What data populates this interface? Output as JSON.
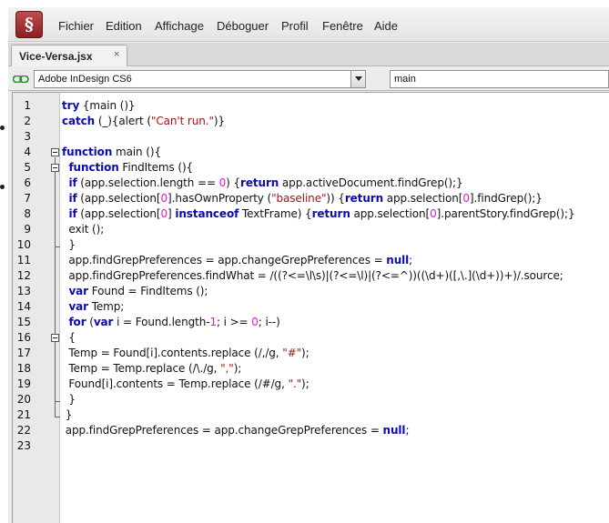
{
  "window": {
    "menu": [
      "Fichier",
      "Edition",
      "Affichage",
      "Déboguer",
      "Profil",
      "Fenêtre",
      "Aide"
    ]
  },
  "tab": {
    "label": "Vice-Versa.jsx",
    "close_glyph": "×"
  },
  "target": {
    "application": "Adobe InDesign CS6",
    "function": "main"
  },
  "icons": {
    "app": "extendscript-toolkit-icon",
    "link": "link-icon"
  },
  "colors": {
    "keyword": "#0b0bb0",
    "string": "#a31515",
    "number": "#e01ad8"
  },
  "editor": {
    "lines": [
      [
        {
          "t": "try",
          "c": "kw"
        },
        {
          "t": " {main ()}"
        }
      ],
      [
        {
          "t": "catch",
          "c": "kw"
        },
        {
          "t": " (_){alert ("
        },
        {
          "t": "\"Can't run.\"",
          "c": "str"
        },
        {
          "t": ")}"
        }
      ],
      [],
      [
        {
          "t": "function",
          "c": "kw"
        },
        {
          "t": " main (){"
        }
      ],
      [
        {
          "t": "  "
        },
        {
          "t": "function",
          "c": "kw"
        },
        {
          "t": " FindItems (){"
        }
      ],
      [
        {
          "t": "  "
        },
        {
          "t": "if",
          "c": "kw"
        },
        {
          "t": " (app.selection.length == "
        },
        {
          "t": "0",
          "c": "num"
        },
        {
          "t": ") {"
        },
        {
          "t": "return",
          "c": "kw"
        },
        {
          "t": " app.activeDocument.findGrep();}"
        }
      ],
      [
        {
          "t": "  "
        },
        {
          "t": "if",
          "c": "kw"
        },
        {
          "t": " (app.selection["
        },
        {
          "t": "0",
          "c": "num"
        },
        {
          "t": "].hasOwnProperty ("
        },
        {
          "t": "\"baseline\"",
          "c": "str"
        },
        {
          "t": ")) {"
        },
        {
          "t": "return",
          "c": "kw"
        },
        {
          "t": " app.selection["
        },
        {
          "t": "0",
          "c": "num"
        },
        {
          "t": "].findGrep();}"
        }
      ],
      [
        {
          "t": "  "
        },
        {
          "t": "if",
          "c": "kw"
        },
        {
          "t": " (app.selection["
        },
        {
          "t": "0",
          "c": "num"
        },
        {
          "t": "] "
        },
        {
          "t": "instanceof",
          "c": "kw"
        },
        {
          "t": " TextFrame) {"
        },
        {
          "t": "return",
          "c": "kw"
        },
        {
          "t": " app.selection["
        },
        {
          "t": "0",
          "c": "num"
        },
        {
          "t": "].parentStory.findGrep();}"
        }
      ],
      [
        {
          "t": "  exit ();"
        }
      ],
      [
        {
          "t": "  }"
        }
      ],
      [
        {
          "t": "  app.findGrepPreferences = app.changeGrepPreferences = "
        },
        {
          "t": "null",
          "c": "kw"
        },
        {
          "t": ";"
        }
      ],
      [
        {
          "t": "  app.findGrepPreferences.findWhat = /((?<=\\l\\s)|(?<=\\l)|(?<=^))((\\d+)([,\\.](\\d+))+)/.source;"
        }
      ],
      [
        {
          "t": "  "
        },
        {
          "t": "var",
          "c": "kw"
        },
        {
          "t": " Found = FindItems ();"
        }
      ],
      [
        {
          "t": "  "
        },
        {
          "t": "var",
          "c": "kw"
        },
        {
          "t": " Temp;"
        }
      ],
      [
        {
          "t": "  "
        },
        {
          "t": "for",
          "c": "kw"
        },
        {
          "t": " ("
        },
        {
          "t": "var",
          "c": "kw"
        },
        {
          "t": " i = Found.length-"
        },
        {
          "t": "1",
          "c": "num"
        },
        {
          "t": "; i >= "
        },
        {
          "t": "0",
          "c": "num"
        },
        {
          "t": "; i--)"
        }
      ],
      [
        {
          "t": "  {"
        }
      ],
      [
        {
          "t": "  Temp = Found[i].contents.replace (/,/g, "
        },
        {
          "t": "\"#\"",
          "c": "str"
        },
        {
          "t": ");"
        }
      ],
      [
        {
          "t": "  Temp = Temp.replace (/\\./g, "
        },
        {
          "t": "\",\"",
          "c": "str"
        },
        {
          "t": ");"
        }
      ],
      [
        {
          "t": "  Found[i].contents = Temp.replace (/#/g, "
        },
        {
          "t": "\".\"",
          "c": "str"
        },
        {
          "t": ");"
        }
      ],
      [
        {
          "t": "  }"
        }
      ],
      [
        {
          "t": " }"
        }
      ],
      [
        {
          "t": " app.findGrepPreferences = app.changeGrepPreferences = "
        },
        {
          "t": "null",
          "c": "kw"
        },
        {
          "t": ";"
        }
      ],
      []
    ]
  }
}
